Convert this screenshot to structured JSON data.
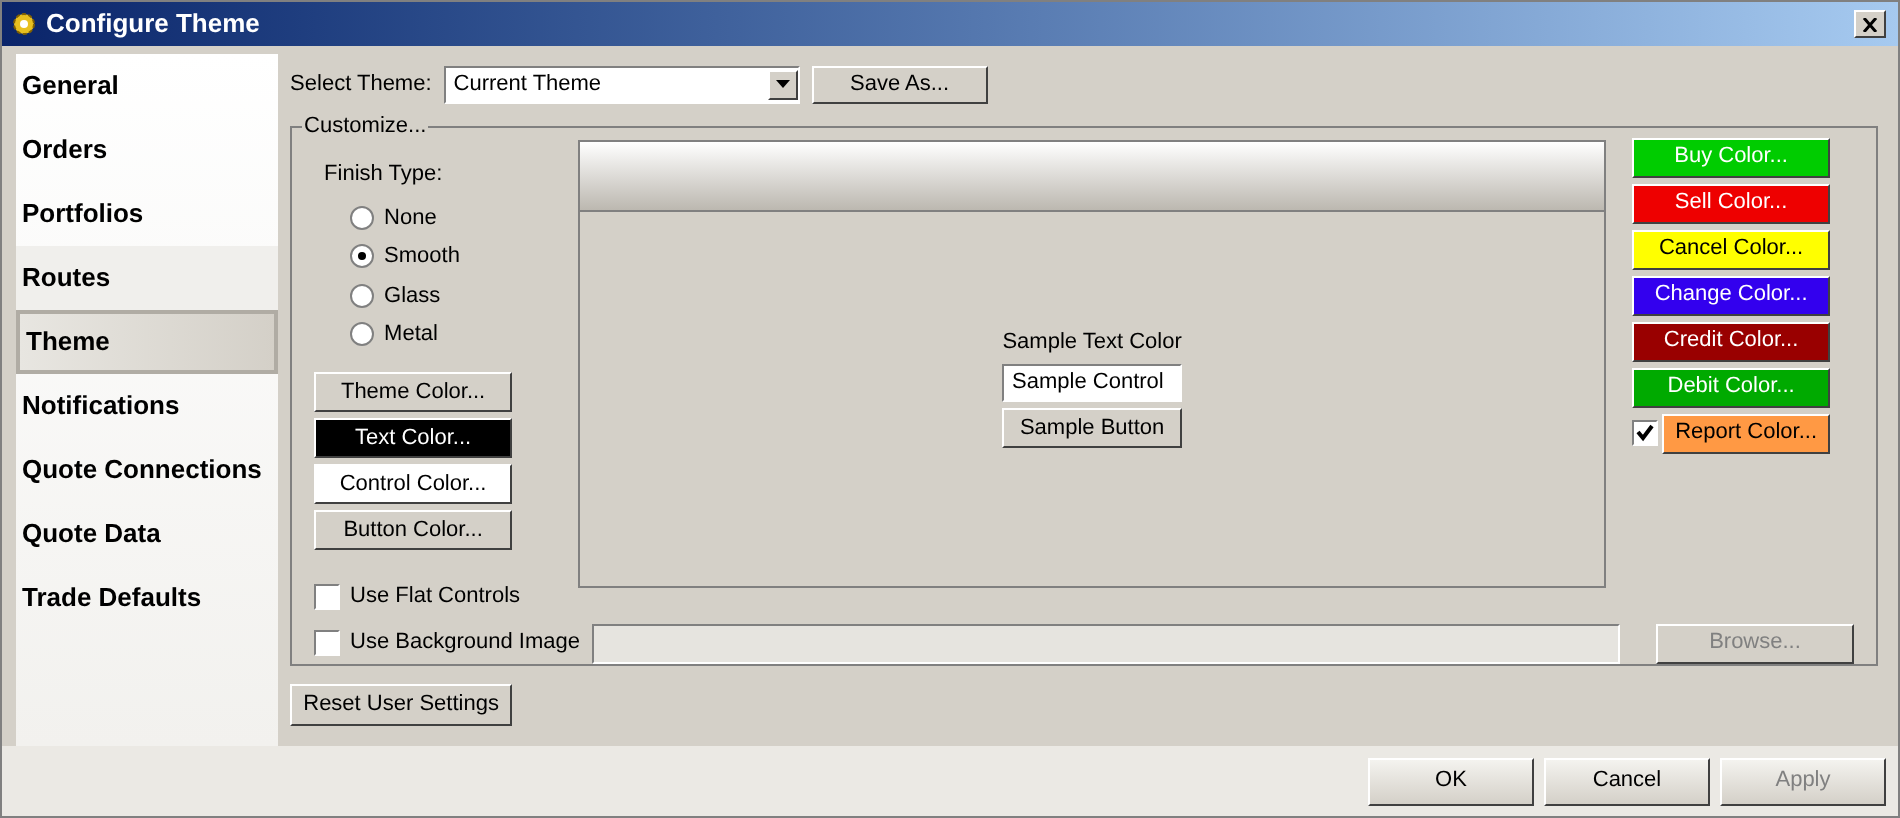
{
  "window": {
    "title": "Configure Theme"
  },
  "sidebar": {
    "items": [
      {
        "label": "General",
        "selected": false
      },
      {
        "label": "Orders",
        "selected": false
      },
      {
        "label": "Portfolios",
        "selected": false
      },
      {
        "label": "Routes",
        "selected": false
      },
      {
        "label": "Theme",
        "selected": true
      },
      {
        "label": "Notifications",
        "selected": false
      },
      {
        "label": "Quote Connections",
        "selected": false
      },
      {
        "label": "Quote Data",
        "selected": false
      },
      {
        "label": "Trade Defaults",
        "selected": false
      }
    ]
  },
  "select_theme": {
    "label": "Select Theme:",
    "value": "Current Theme",
    "save_button": "Save As..."
  },
  "customize": {
    "legend": "Customize...",
    "finish_type": {
      "label": "Finish Type:",
      "options": [
        {
          "label": "None",
          "selected": false
        },
        {
          "label": "Smooth",
          "selected": true
        },
        {
          "label": "Glass",
          "selected": false
        },
        {
          "label": "Metal",
          "selected": false
        }
      ]
    },
    "theme_buttons": [
      {
        "label": "Theme Color...",
        "color": "#d4d0c8"
      },
      {
        "label": "Text Color...",
        "color": "#000000"
      },
      {
        "label": "Control Color...",
        "color": "#ffffff"
      },
      {
        "label": "Button Color...",
        "color": "#d4d0c8"
      }
    ],
    "use_flat_controls": {
      "label": "Use Flat Controls",
      "checked": false
    },
    "use_background_image": {
      "label": "Use Background Image",
      "checked": false
    },
    "browse_button": {
      "label": "Browse...",
      "disabled": true
    },
    "preview": {
      "sample_text": "Sample Text Color",
      "sample_control": "Sample Control",
      "sample_button": "Sample Button"
    },
    "order_buttons": [
      {
        "label": "Buy Color...",
        "color": "#00cc00"
      },
      {
        "label": "Sell Color...",
        "color": "#ee0000"
      },
      {
        "label": "Cancel Color...",
        "color": "#ffff00"
      },
      {
        "label": "Change Color...",
        "color": "#3300ee"
      },
      {
        "label": "Credit Color...",
        "color": "#990000"
      },
      {
        "label": "Debit Color...",
        "color": "#00aa00"
      }
    ],
    "report_button": {
      "label": "Report Color...",
      "color": "#ff9944",
      "checked": true
    }
  },
  "reset_button": "Reset User Settings",
  "footer_buttons": [
    {
      "label": "OK",
      "disabled": false
    },
    {
      "label": "Cancel",
      "disabled": false
    },
    {
      "label": "Apply",
      "disabled": true
    }
  ]
}
